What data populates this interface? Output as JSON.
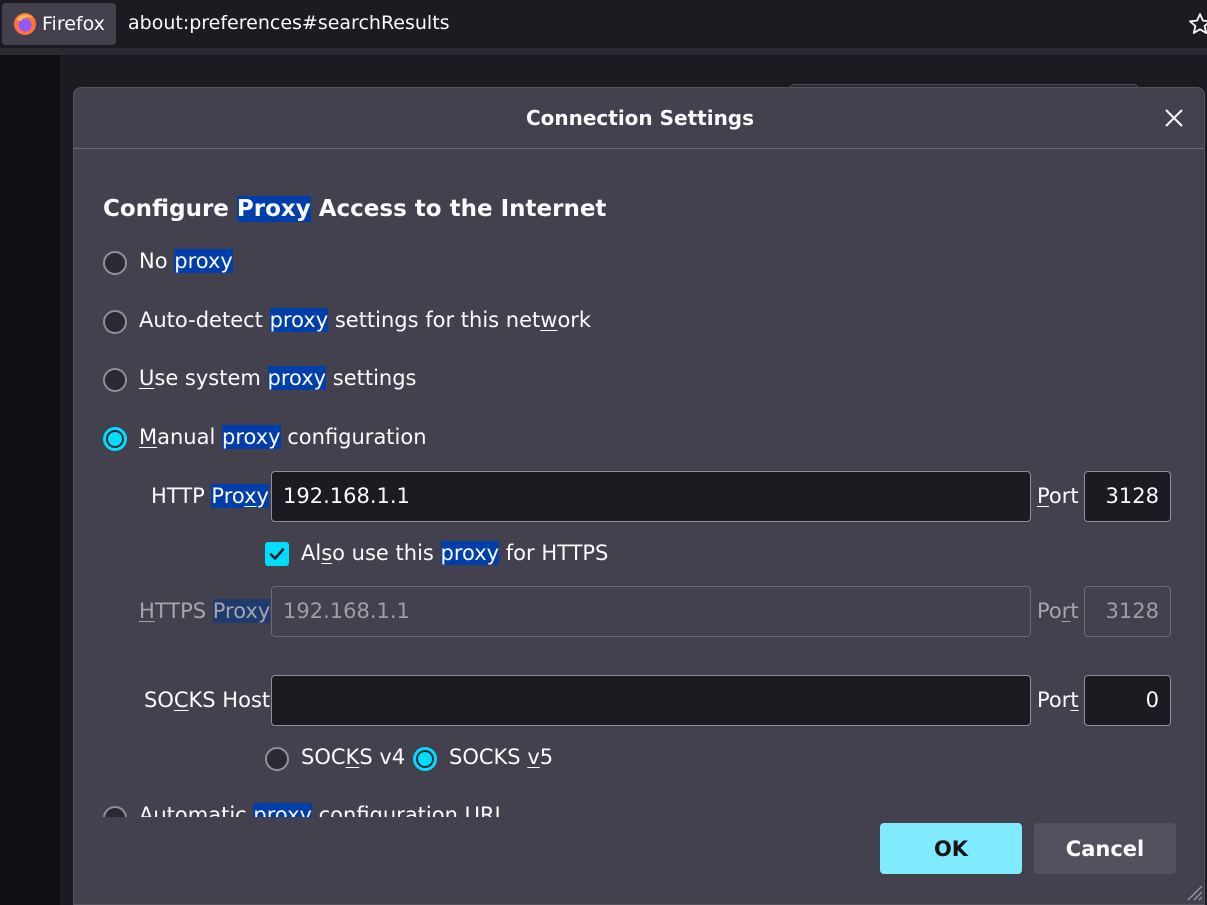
{
  "browser": {
    "identity_label": "Firefox",
    "url": "about:preferences#searchResults"
  },
  "dialog": {
    "title": "Connection Settings",
    "heading": {
      "before": "Configure ",
      "highlight": "Proxy",
      "after": " Access to the Internet"
    },
    "options": {
      "no_proxy": {
        "before": "No ",
        "highlight": "proxy",
        "after": "",
        "checked": false
      },
      "auto_detect": {
        "before": "Auto-detect ",
        "highlight": "proxy",
        "after_1": " settings for this net",
        "accesskey": "w",
        "after_2": "ork",
        "checked": false
      },
      "system": {
        "accesskey": "U",
        "before": "se system ",
        "highlight": "proxy",
        "after": " settings",
        "checked": false
      },
      "manual": {
        "accesskey": "M",
        "before": "anual ",
        "highlight": "proxy",
        "after": " configuration",
        "checked": true
      },
      "automatic_url": {
        "before": "Automatic ",
        "highlight": "proxy",
        "after": " configuration URL",
        "checked": false
      }
    },
    "http": {
      "label_before": "HTTP ",
      "label_highlight_1": "Pro",
      "label_accesskey": "x",
      "label_highlight_2": "y",
      "value": "192.168.1.1",
      "port_label_1": "",
      "port_accesskey": "P",
      "port_label_2": "ort",
      "port_value": "3128"
    },
    "also_https": {
      "before": "Al",
      "accesskey": "s",
      "middle": "o use this ",
      "highlight": "proxy",
      "after": " for HTTPS",
      "checked": true
    },
    "https": {
      "label_accesskey": "H",
      "label_before": "TTPS ",
      "label_highlight": "Proxy",
      "value": "192.168.1.1",
      "port_label_1": "Po",
      "port_accesskey": "r",
      "port_label_2": "t",
      "port_value": "3128"
    },
    "socks": {
      "label_before": "SO",
      "label_accesskey": "C",
      "label_after": "KS Host",
      "value": "",
      "port_label_1": "Por",
      "port_accesskey": "t",
      "port_label_2": "",
      "port_value": "0",
      "v4": {
        "before": "SOC",
        "accesskey": "K",
        "after": "S v4",
        "checked": false
      },
      "v5": {
        "before": "SOCKS ",
        "accesskey": "v",
        "after": "5",
        "checked": true
      }
    },
    "buttons": {
      "ok": "OK",
      "cancel": "Cancel"
    }
  },
  "colors": {
    "accent": "#00ddff",
    "ok_button": "#80ebff",
    "highlight": "#003eaa",
    "dialog_bg": "#42414d"
  },
  "icons": {
    "browser_identity": "firefox-logo-icon",
    "bookmark": "star-icon",
    "close": "close-icon",
    "check": "checkmark-icon",
    "resize": "resize-grip-icon"
  }
}
